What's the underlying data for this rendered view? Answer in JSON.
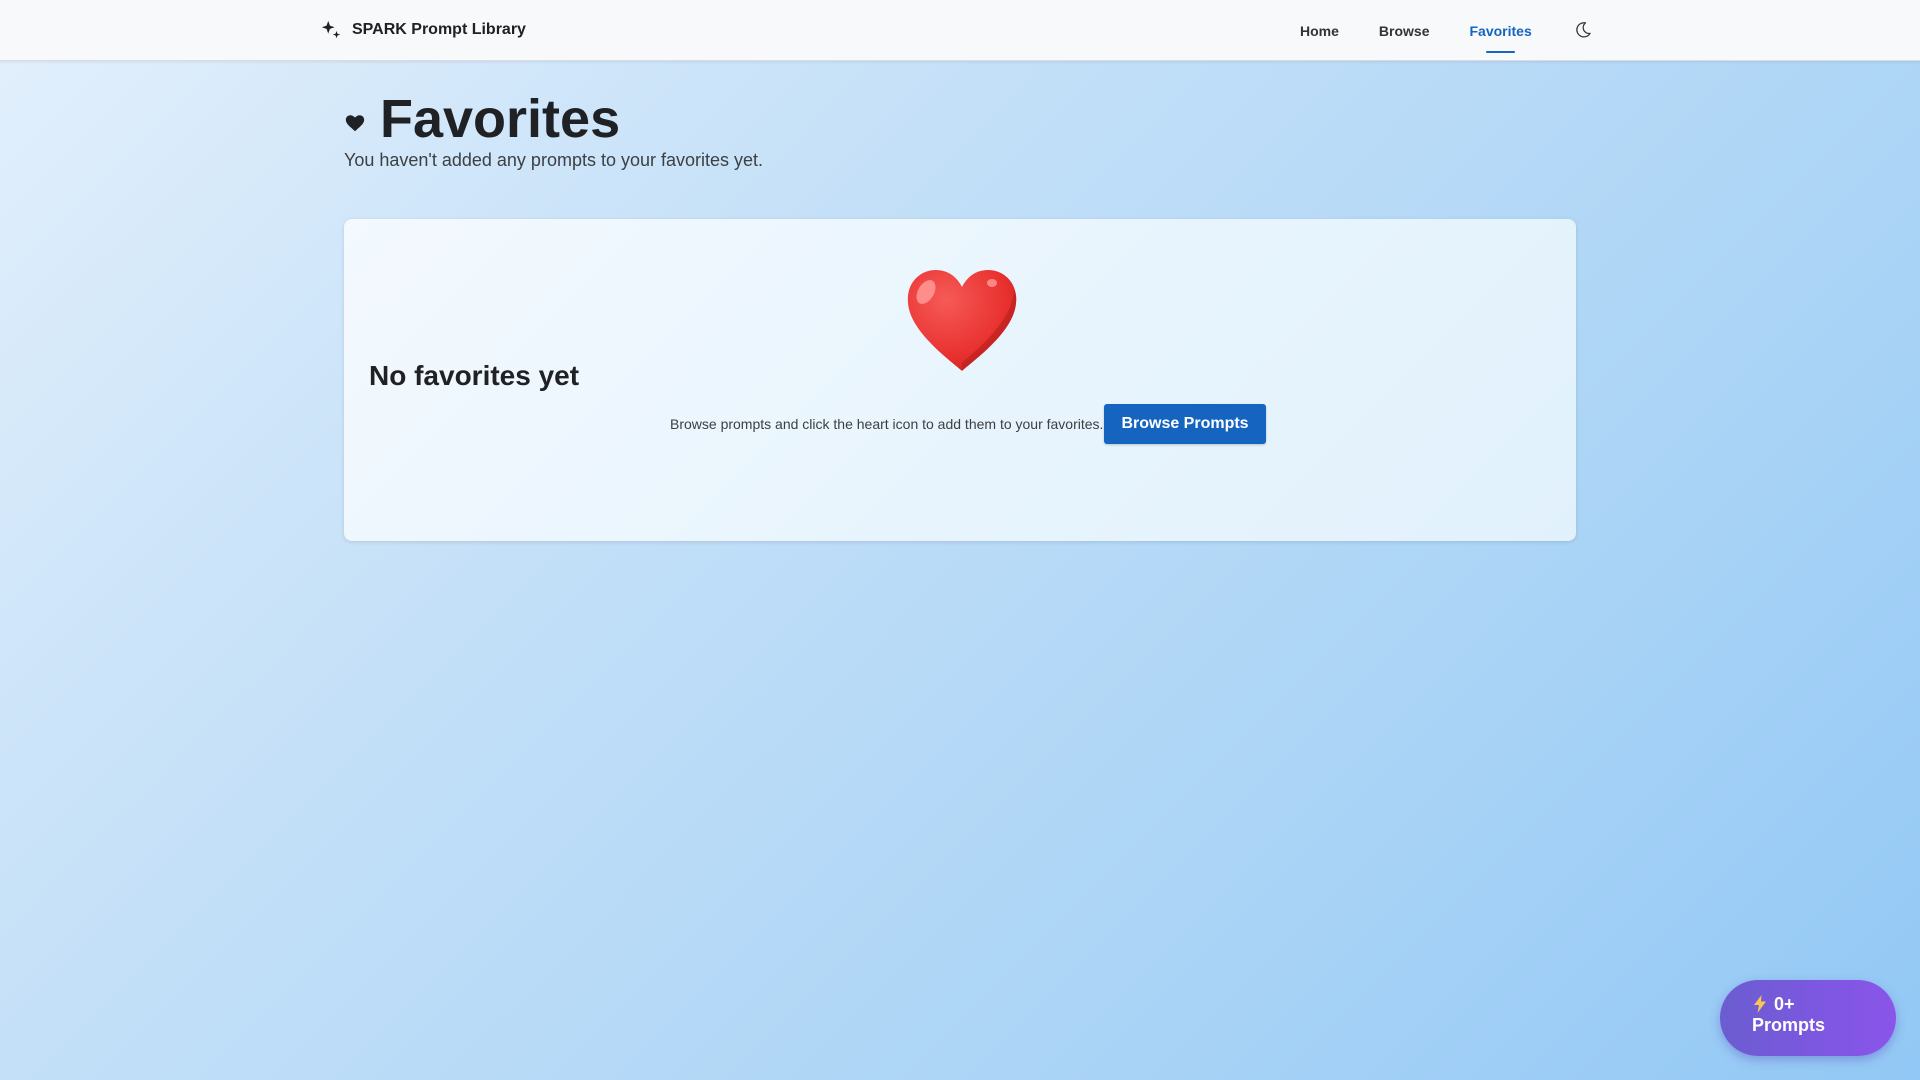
{
  "header": {
    "brand_icon": "sparkles-icon",
    "brand_title": "SPARK Prompt Library",
    "nav": [
      {
        "label": "Home",
        "active": false
      },
      {
        "label": "Browse",
        "active": false
      },
      {
        "label": "Favorites",
        "active": true
      }
    ],
    "theme_toggle_icon": "moon-icon",
    "accent_color": "#1565c0"
  },
  "page": {
    "title_icon": "heart-icon",
    "title": "Favorites",
    "subtitle": "You haven't added any prompts to your favorites yet."
  },
  "empty_state": {
    "icon": "red-heart-icon",
    "title": "No favorites yet",
    "text": "Browse prompts and click the heart icon to add them to your favorites.",
    "button_label": "Browse Prompts"
  },
  "floating_badge": {
    "icon": "lightning-icon",
    "count_text": "0+",
    "label": "Prompts"
  }
}
